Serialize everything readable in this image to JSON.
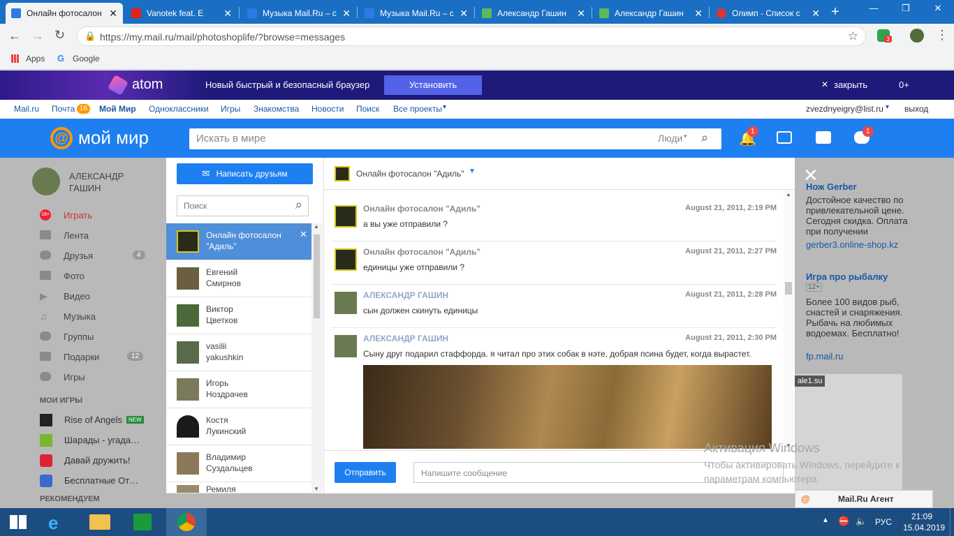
{
  "browser": {
    "tabs": [
      {
        "title": "Онлайн фотосалон",
        "active": true
      },
      {
        "title": "Vanotek feat. E"
      },
      {
        "title": "Музыка Mail.Ru – с"
      },
      {
        "title": "Музыка Mail.Ru – с"
      },
      {
        "title": "Александр Гашин"
      },
      {
        "title": "Александр Гашин"
      },
      {
        "title": "Олимп - Список с"
      }
    ],
    "url": "https://my.mail.ru/mail/photoshoplife/?browse=messages",
    "bookmarks": {
      "apps": "Apps",
      "google": "Google"
    },
    "ext_badge": "3"
  },
  "atom_banner": {
    "logo": "atom",
    "text": "Новый быстрый и безопасный браузер",
    "install": "Установить",
    "close": "закрыть",
    "age": "0+"
  },
  "mail_nav": {
    "mailru": "Mail.ru",
    "pochta": "Почта",
    "pochta_count": "16",
    "moy_mir": "Мой Мир",
    "ok": "Одноклассники",
    "games": "Игры",
    "dating": "Знакомства",
    "news": "Новости",
    "search": "Поиск",
    "all": "Все проекты",
    "email": "zvezdnyeigry@list.ru",
    "logout": "выход"
  },
  "header": {
    "logo": "мой мир",
    "search_placeholder": "Искать в мире",
    "search_scope": "Люди",
    "notif_badge": "1",
    "games_badge": "1"
  },
  "left_nav": {
    "user_name": "АЛЕКСАНДР ГАШИН",
    "items": [
      {
        "label": "Играть",
        "badge": ""
      },
      {
        "label": "Лента",
        "badge": ""
      },
      {
        "label": "Друзья",
        "badge": "4"
      },
      {
        "label": "Фото",
        "badge": ""
      },
      {
        "label": "Видео",
        "badge": ""
      },
      {
        "label": "Музыка",
        "badge": ""
      },
      {
        "label": "Группы",
        "badge": ""
      },
      {
        "label": "Подарки",
        "badge": "12"
      },
      {
        "label": "Игры",
        "badge": ""
      }
    ],
    "my_games_title": "МОИ ИГРЫ",
    "games": [
      {
        "label": "Rise of Angels",
        "badge": "NEW"
      },
      {
        "label": "Шарады - угада…"
      },
      {
        "label": "Давай дружить!"
      },
      {
        "label": "Бесплатные От…"
      }
    ],
    "recommend_title": "РЕКОМЕНДУЕМ",
    "age_badge": "18+"
  },
  "dialog": {
    "write_friends": "Написать друзьям",
    "search_placeholder": "Поиск",
    "contacts": [
      {
        "line1": "Онлайн фотосалон",
        "line2": "\"Адиль\"",
        "selected": true
      },
      {
        "line1": "Евгений",
        "line2": "Смирнов"
      },
      {
        "line1": "Виктор",
        "line2": "Цветков"
      },
      {
        "line1": "vasilii",
        "line2": "yakushkin"
      },
      {
        "line1": "Игорь",
        "line2": "Ноздрачев"
      },
      {
        "line1": "Костя",
        "line2": "Лукинский"
      },
      {
        "line1": "Владимир",
        "line2": "Суздальцев"
      },
      {
        "line1": "Ремиля",
        "line2": ""
      }
    ],
    "chat_title": "Онлайн фотосалон \"Адиль\"",
    "messages": [
      {
        "author": "Онлайн фотосалон \"Адиль\"",
        "time": "August 21, 2011, 2:19 PM",
        "text": "а вы уже отправили ?"
      },
      {
        "author": "Онлайн фотосалон \"Адиль\"",
        "time": "August 21, 2011, 2:27 PM",
        "text": "единицы уже отправили ?"
      },
      {
        "author": "АЛЕКСАНДР ГАШИН",
        "time": "August 21, 2011, 2:28 PM",
        "text": "сын должен скинуть единицы"
      },
      {
        "author": "АЛЕКСАНДР ГАШИН",
        "time": "August 21, 2011, 2:30 PM",
        "text": "Сыну друг подарил стаффорда. я читал про этих собак в нэте, добрая псина будет, когда вырастет."
      }
    ],
    "send": "Отправить",
    "input_placeholder": "Напишите сообщение"
  },
  "ads": {
    "ad1_title": "Нож Gerber",
    "ad1_text": "Достойное качество по привлекательной цене. Сегодня скидка. Оплата при получении",
    "ad1_link": "gerber3.online-shop.kz",
    "ad2_title": "Игра про рыбалку",
    "ad2_age": "12+",
    "ad2_text": "Более 100 видов рыб, снастей и снаряжения. Рыбачь на любимых водоемах. Бесплатно!",
    "ad2_link": "fp.mail.ru",
    "tag": "ale1.su"
  },
  "activation": {
    "title": "Активация Windows",
    "text": "Чтобы активировать Windows, перейдите к параметрам компьютера."
  },
  "agent": "Mail.Ru Агент",
  "taskbar": {
    "lang": "РУС",
    "time": "21:09",
    "date": "15.04.2019"
  },
  "colors": {
    "brand": "#1e7ff0",
    "tabbar": "#1a6fc4",
    "badge": "#f04747",
    "taskbar": "#1c4d80"
  }
}
